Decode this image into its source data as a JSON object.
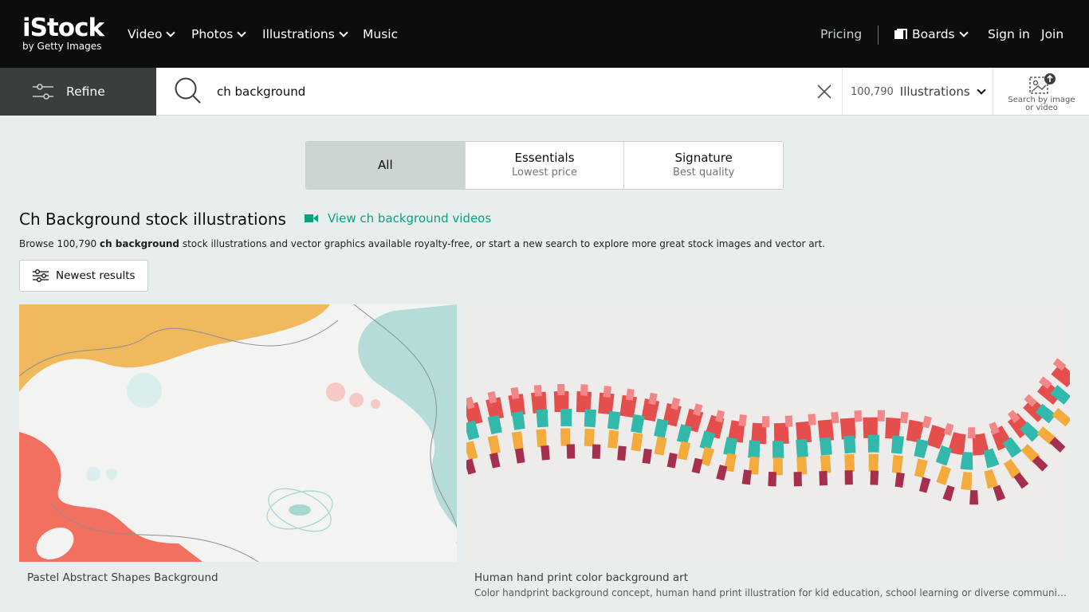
{
  "brand": {
    "name": "iStock",
    "tagline": "by Getty Images"
  },
  "nav": {
    "video": "Video",
    "photos": "Photos",
    "illustrations": "Illustrations",
    "music": "Music",
    "pricing": "Pricing",
    "boards": "Boards",
    "signin": "Sign in",
    "join": "Join"
  },
  "search": {
    "refine_label": "Refine",
    "query": "ch background",
    "result_count": "100,790",
    "asset_type": "Illustrations",
    "search_by_image_line1": "Search by image",
    "search_by_image_line2": "or video"
  },
  "license_tabs": [
    {
      "title": "All",
      "subtitle": "",
      "active": true
    },
    {
      "title": "Essentials",
      "subtitle": "Lowest price",
      "active": false
    },
    {
      "title": "Signature",
      "subtitle": "Best quality",
      "active": false
    }
  ],
  "results_header": {
    "title": "Ch Background stock illustrations",
    "videos_link": "View ch background videos",
    "browse_prefix": "Browse 100,790 ",
    "browse_term": "ch background",
    "browse_suffix": " stock illustrations and vector graphics available royalty-free, or start a new search to explore more great stock images and vector art."
  },
  "sort": {
    "label": "Newest results"
  },
  "results": [
    {
      "title": "Pastel Abstract Shapes Background",
      "description": ""
    },
    {
      "title": "Human hand print color background art",
      "description": "Color handprint background concept, human hand print illustration for kid education, school learning or diverse community help..."
    }
  ],
  "colors": {
    "nav_bg": "#0c0d0d",
    "refine_bg": "#3b3e3e",
    "page_bg": "#e8eeee",
    "accent_green": "#08a282",
    "active_tab": "#cbd4d3"
  }
}
